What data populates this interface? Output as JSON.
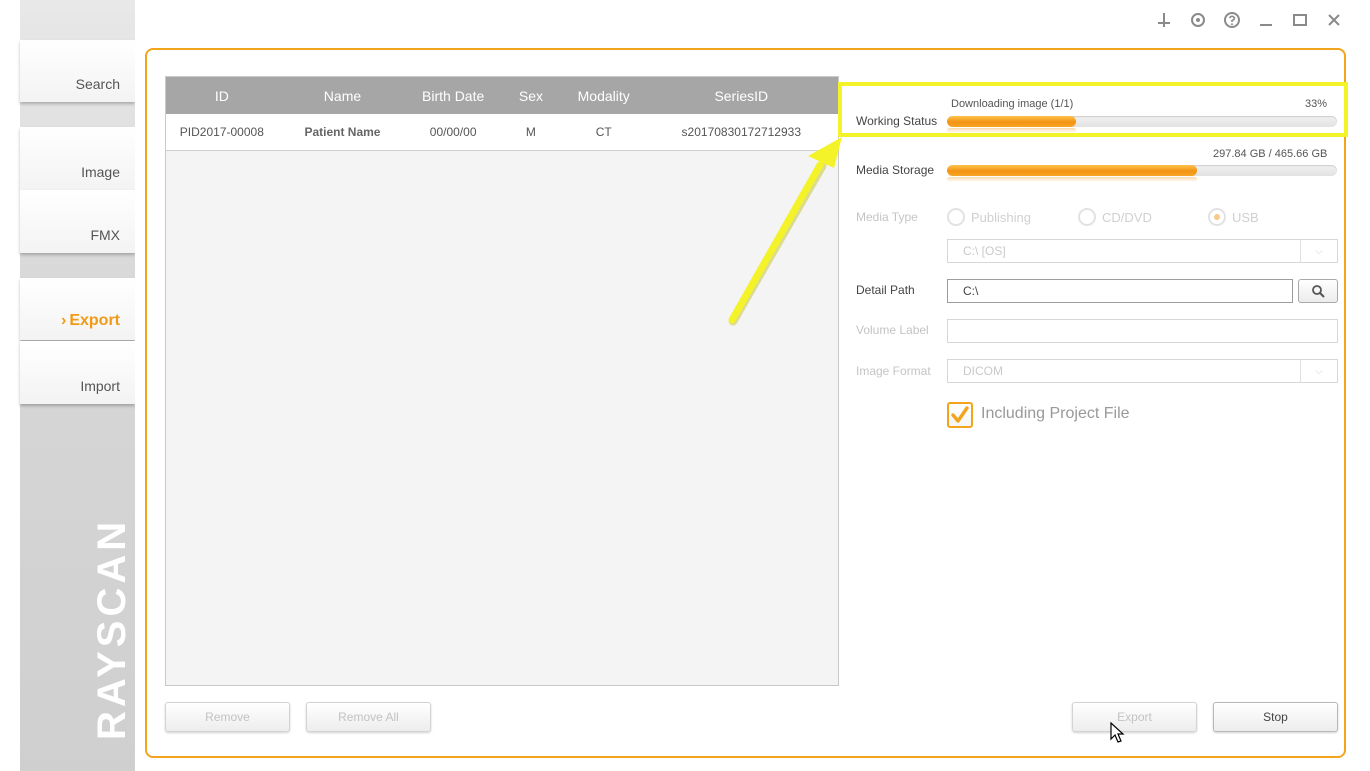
{
  "sidebar": {
    "items": [
      {
        "label": "Search"
      },
      {
        "label": "Image"
      },
      {
        "label": "FMX"
      },
      {
        "label": "Export",
        "active": true
      },
      {
        "label": "Import"
      }
    ],
    "brand": "RAYSCAN"
  },
  "window_controls": [
    "pin-icon",
    "settings-icon",
    "help-icon",
    "minimize-icon",
    "maximize-icon",
    "close-icon"
  ],
  "table": {
    "columns": [
      "ID",
      "Name",
      "Birth Date",
      "Sex",
      "Modality",
      "SeriesID"
    ],
    "rows": [
      [
        "PID2017-00008",
        "Patient Name",
        "00/00/00",
        "M",
        "CT",
        "s20170830172712933"
      ]
    ]
  },
  "buttons": {
    "remove": "Remove",
    "remove_all": "Remove All",
    "export": "Export",
    "stop": "Stop"
  },
  "working_status": {
    "label": "Working Status",
    "message": "Downloading image (1/1)",
    "percent_text": "33%",
    "progress": 0.33
  },
  "media_storage": {
    "label": "Media Storage",
    "usage_text": "297.84 GB / 465.66 GB",
    "progress": 0.64
  },
  "media_type": {
    "label": "Media Type",
    "options": [
      "Publishing",
      "CD/DVD",
      "USB"
    ],
    "selected": "USB",
    "drive_value": "C:\\ [OS]"
  },
  "detail_path": {
    "label": "Detail Path",
    "value": "C:\\"
  },
  "volume_label": {
    "label": "Volume Label",
    "value": ""
  },
  "image_format": {
    "label": "Image Format",
    "value": "DICOM"
  },
  "including_project_file": {
    "label": "Including Project File",
    "checked": true
  },
  "colors": {
    "accent": "#f2a51c",
    "highlight": "#f4f32a"
  }
}
